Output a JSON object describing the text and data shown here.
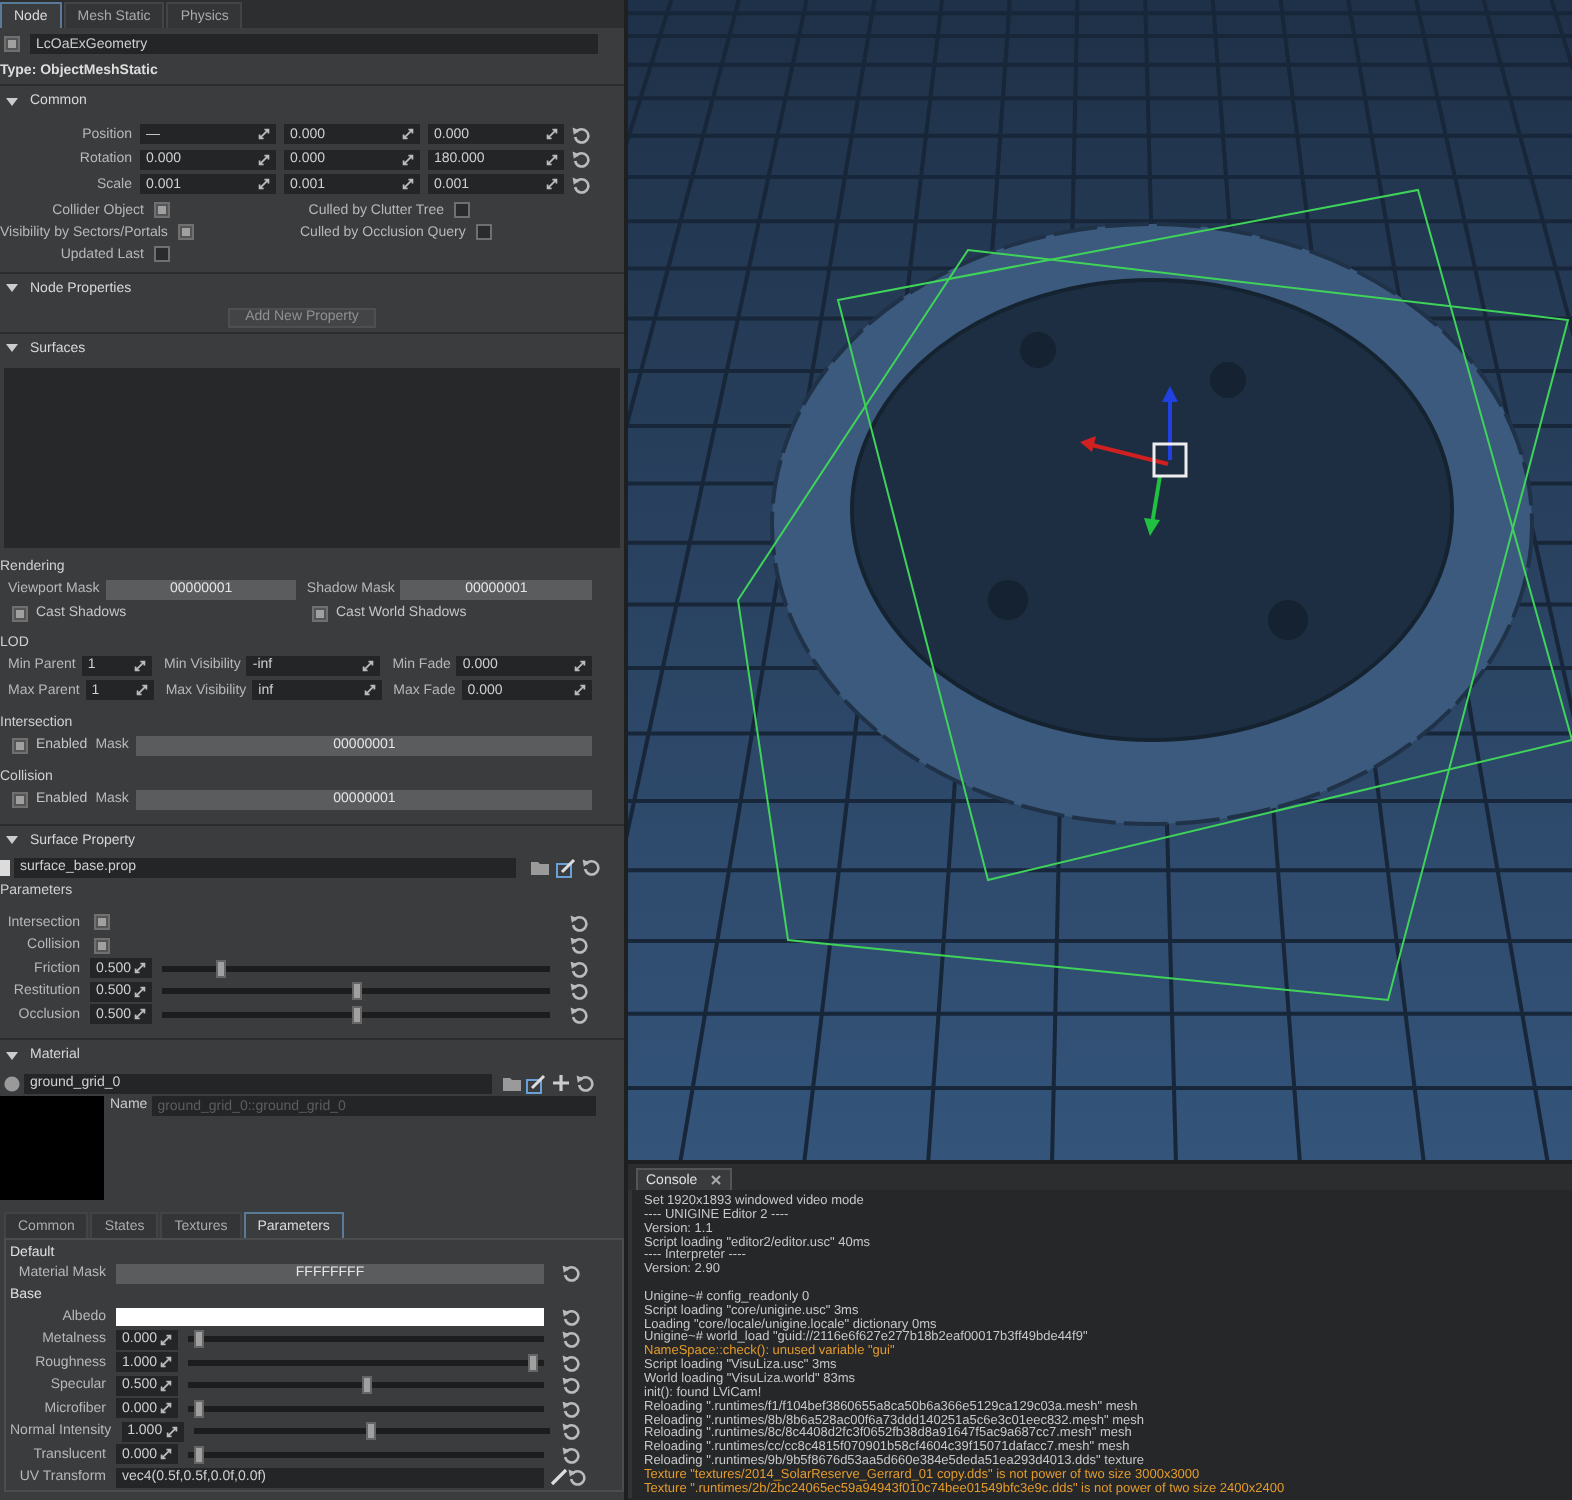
{
  "inspector_tabs": [
    {
      "label": "Node",
      "selected": true
    },
    {
      "label": "Mesh Static",
      "selected": false
    },
    {
      "label": "Physics",
      "selected": false
    }
  ],
  "node": {
    "enabled": true,
    "name": "LcOaExGeometry",
    "type": "Type: ObjectMeshStatic"
  },
  "common": {
    "title": "Common",
    "expanded": true,
    "transform": [
      {
        "label": "Position",
        "values": [
          "—",
          "0.000",
          "0.000"
        ]
      },
      {
        "label": "Rotation",
        "values": [
          "0.000",
          "0.000",
          "180.000"
        ]
      },
      {
        "label": "Scale",
        "values": [
          "0.001",
          "0.001",
          "0.001"
        ]
      }
    ],
    "flags": [
      {
        "label": "Collider Object",
        "checked": true
      },
      {
        "label": "Culled by Clutter Tree",
        "checked": false
      },
      {
        "label": "Visibility by Sectors/Portals",
        "checked": true
      },
      {
        "label": "Culled by Occlusion Query",
        "checked": false
      },
      {
        "label": "Updated Last",
        "checked": false
      }
    ]
  },
  "node_properties": {
    "title": "Node Properties",
    "expanded": true,
    "button": {
      "label": "Add New Property",
      "disabled": true
    }
  },
  "surfaces": {
    "title": "Surfaces",
    "expanded": true,
    "rendering": {
      "title": "Rendering",
      "masks": [
        {
          "label": "Viewport Mask",
          "value": "00000001"
        },
        {
          "label": "Shadow Mask",
          "value": "00000001"
        }
      ],
      "flags": [
        {
          "label": "Cast Shadows",
          "checked": true
        },
        {
          "label": "Cast World Shadows",
          "checked": true
        }
      ]
    },
    "lod": {
      "title": "LOD",
      "fields": [
        {
          "label": "Min Parent",
          "value": "1"
        },
        {
          "label": "Min Visibility",
          "value": "-inf"
        },
        {
          "label": "Min Fade",
          "value": "0.000"
        },
        {
          "label": "Max Parent",
          "value": "1"
        },
        {
          "label": "Max Visibility",
          "value": "inf"
        },
        {
          "label": "Max Fade",
          "value": "0.000"
        }
      ]
    },
    "masks": [
      {
        "title": "Intersection",
        "enabled": true,
        "enabled_label": "Enabled",
        "mask_label": "Mask",
        "mask": "00000001"
      },
      {
        "title": "Collision",
        "enabled": true,
        "enabled_label": "Enabled",
        "mask_label": "Mask",
        "mask": "00000001"
      }
    ]
  },
  "surface_property": {
    "title": "Surface Property",
    "expanded": true,
    "file": "surface_base.prop",
    "parameters_title": "Parameters",
    "parameters": [
      {
        "kind": "checkbox",
        "label": "Intersection",
        "checked": true
      },
      {
        "kind": "checkbox",
        "label": "Collision",
        "checked": true
      },
      {
        "kind": "slider",
        "label": "Friction",
        "value": "0.500",
        "level": 0.13
      },
      {
        "kind": "slider",
        "label": "Restitution",
        "value": "0.500",
        "level": 0.5
      },
      {
        "kind": "slider",
        "label": "Occlusion",
        "value": "0.500",
        "level": 0.5
      }
    ]
  },
  "material": {
    "title": "Material",
    "expanded": true,
    "file": "ground_grid_0",
    "name_label": "Name",
    "name": "ground_grid_0::ground_grid_0",
    "tabs": [
      {
        "label": "Common",
        "selected": false
      },
      {
        "label": "States",
        "selected": false
      },
      {
        "label": "Textures",
        "selected": false
      },
      {
        "label": "Parameters",
        "selected": true
      }
    ],
    "groups": [
      {
        "title": "Default",
        "params": [
          {
            "kind": "mask",
            "label": "Material Mask",
            "value": "FFFFFFFF"
          }
        ]
      },
      {
        "title": "Base",
        "params": [
          {
            "kind": "color",
            "label": "Albedo",
            "color": "#ffffff"
          },
          {
            "kind": "slider",
            "label": "Metalness",
            "value": "0.000",
            "level": 0
          },
          {
            "kind": "slider",
            "label": "Roughness",
            "value": "1.000",
            "level": 1
          },
          {
            "kind": "slider",
            "label": "Specular",
            "value": "0.500",
            "level": 0.5
          },
          {
            "kind": "slider",
            "label": "Microfiber",
            "value": "0.000",
            "level": 0
          },
          {
            "kind": "slider",
            "label": "Normal Intensity",
            "value": "1.000",
            "level": 0.5
          },
          {
            "kind": "slider",
            "label": "Translucent",
            "value": "0.000",
            "level": 0
          },
          {
            "kind": "text",
            "label": "UV Transform",
            "value": "vec4(0.5f,0.5f,0.0f,0.0f)"
          }
        ]
      }
    ]
  },
  "console": {
    "tab": {
      "label": "Console",
      "selected": true
    },
    "lines": [
      {
        "kind": "info",
        "text": "Set 1920x1893 windowed video mode"
      },
      {
        "kind": "info",
        "text": "---- UNIGINE Editor 2 ----"
      },
      {
        "kind": "info",
        "text": "Version: 1.1"
      },
      {
        "kind": "info",
        "text": "Script loading \"editor2/editor.usc\" 40ms"
      },
      {
        "kind": "info",
        "text": "---- Interpreter ----"
      },
      {
        "kind": "info",
        "text": "Version: 2.90"
      },
      {
        "kind": "blank"
      },
      {
        "kind": "info",
        "text": "Unigine~# config_readonly 0"
      },
      {
        "kind": "info",
        "text": "Script loading \"core/unigine.usc\" 3ms"
      },
      {
        "kind": "info",
        "text": "Loading \"core/locale/unigine.locale\" dictionary 0ms"
      },
      {
        "kind": "info",
        "text": "Unigine~# world_load \"guid://2116e6f627e277b18b2eaf00017b3ff49bde44f9\""
      },
      {
        "kind": "warning",
        "text": "NameSpace::check(): unused variable \"gui\""
      },
      {
        "kind": "info",
        "text": "Script loading \"VisuLiza.usc\" 3ms"
      },
      {
        "kind": "info",
        "text": "World loading \"VisuLiza.world\" 83ms"
      },
      {
        "kind": "info",
        "text": "init(): found LViCam!"
      },
      {
        "kind": "info",
        "text": "Reloading \".runtimes/f1/f104bef3860655a8ca50b6a366e5129ca129c03a.mesh\" mesh"
      },
      {
        "kind": "info",
        "text": "Reloading \".runtimes/8b/8b6a528ac00f6a73ddd140251a5c6e3c01eec832.mesh\" mesh"
      },
      {
        "kind": "info",
        "text": "Reloading \".runtimes/8c/8c4408d2fc3f0652fb38d8a91647f5ac9a687cc7.mesh\" mesh"
      },
      {
        "kind": "info",
        "text": "Reloading \".runtimes/cc/cc8c4815f070901b58cf4604c39f15071dafacc7.mesh\" mesh"
      },
      {
        "kind": "info",
        "text": "Reloading \".runtimes/9b/9b5f8676d53aa5d660e384e5deda51ea293d4013.dds\" texture"
      },
      {
        "kind": "warning",
        "text": "Texture \"textures/2014_SolarReserve_Gerrard_01 copy.dds\" is not power of two size 3000x3000"
      },
      {
        "kind": "warning",
        "text": "Texture \".runtimes/2b/2bc24065ec59a94943f010c74bee01549bfc3e9c.dds\" is not power of two size 2400x2400"
      }
    ]
  }
}
